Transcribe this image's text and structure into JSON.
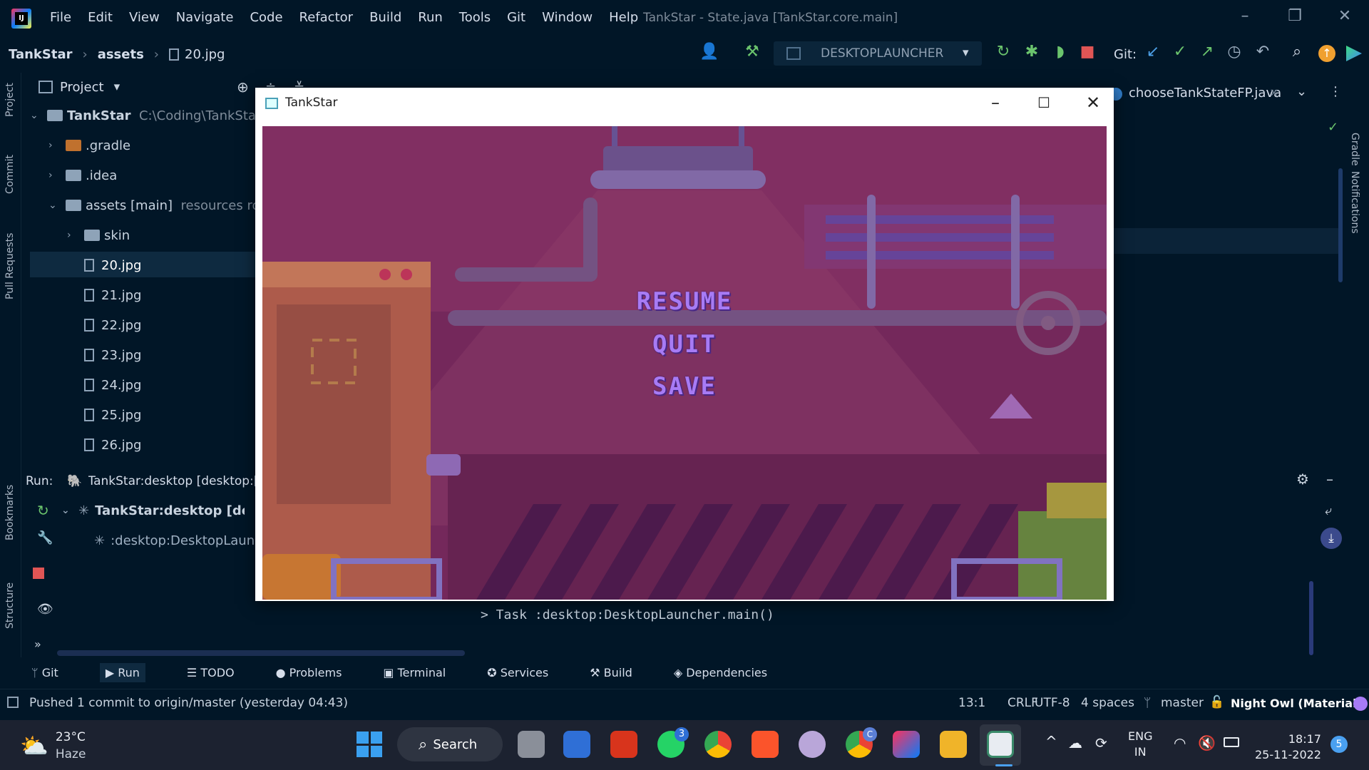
{
  "menubar": {
    "items": [
      "File",
      "Edit",
      "View",
      "Navigate",
      "Code",
      "Refactor",
      "Build",
      "Run",
      "Tools",
      "Git",
      "Window",
      "Help"
    ],
    "window_title": "TankStar - State.java [TankStar.core.main]"
  },
  "breadcrumb": {
    "project": "TankStar",
    "folder": "assets",
    "file": "20.jpg"
  },
  "toolbar": {
    "run_config": "DESKTOPLAUNCHER",
    "git_label": "Git:"
  },
  "left_strip": {
    "project": "Project",
    "commit": "Commit",
    "pull_requests": "Pull Requests",
    "bookmarks": "Bookmarks",
    "structure": "Structure"
  },
  "right_strip": {
    "gradle": "Gradle",
    "notifications": "Notifications"
  },
  "project_panel": {
    "header": "Project",
    "tree": [
      {
        "label": "TankStar",
        "extra": "C:\\Coding\\TankStar"
      },
      {
        "label": ".gradle"
      },
      {
        "label": ".idea"
      },
      {
        "label": "assets [main]",
        "extra": "resources root"
      },
      {
        "label": "skin"
      },
      {
        "label": "20.jpg"
      },
      {
        "label": "21.jpg"
      },
      {
        "label": "22.jpg"
      },
      {
        "label": "23.jpg"
      },
      {
        "label": "24.jpg"
      },
      {
        "label": "25.jpg"
      },
      {
        "label": "26.jpg"
      }
    ]
  },
  "editor": {
    "tab_label": "chooseTankStateFP.java"
  },
  "run_panel": {
    "label": "Run:",
    "tab": "TankStar:desktop [desktop:[",
    "tree_root": "TankStar:desktop [deskto",
    "tree_child": ":desktop:DesktopLaunche",
    "console_line": "> Task :desktop:DesktopLauncher.main()"
  },
  "tool_tabs": [
    "Git",
    "Run",
    "TODO",
    "Problems",
    "Terminal",
    "Services",
    "Build",
    "Dependencies"
  ],
  "statusbar": {
    "message": "Pushed 1 commit to origin/master (yesterday 04:43)",
    "position": "13:1",
    "line_sep": "CRLF",
    "encoding": "UTF-8",
    "indent": "4 spaces",
    "branch": "master",
    "theme": "Night Owl (Material)"
  },
  "game_window": {
    "title": "TankStar",
    "menu_items": [
      "RESUME",
      "QUIT",
      "SAVE"
    ]
  },
  "taskbar": {
    "temperature": "23°C",
    "weather": "Haze",
    "search": "Search",
    "whatsapp_badge": "3",
    "chrome_badge": "C",
    "lang1": "ENG",
    "lang2": "IN",
    "time": "18:17",
    "date": "25-11-2022",
    "notif_count": "5"
  },
  "colors": {
    "ide_bg": "#011627",
    "accent": "#a77bf5",
    "game_bg": "#7b2a5e"
  }
}
